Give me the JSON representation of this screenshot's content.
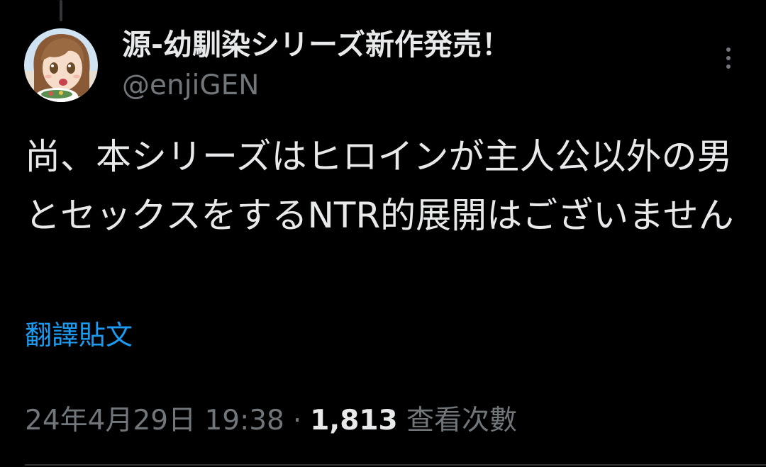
{
  "author": {
    "display_name": "源-幼馴染シリーズ新作発売！",
    "handle": "@enjiGEN",
    "avatar_icon": "anime-girl-avatar-icon"
  },
  "tweet": {
    "text": "尚、本シリーズはヒロインが主人公以外の男とセックスをするNTR的展開はございません",
    "translate_label": "翻譯貼文"
  },
  "meta": {
    "timestamp": "24年4月29日 19:38",
    "separator": "·",
    "views_count": "1,813",
    "views_label": "查看次數"
  },
  "icons": {
    "more": "more-vertical-icon"
  },
  "colors": {
    "background": "#000000",
    "primary_text": "#e7e9ea",
    "secondary_text": "#71767b",
    "link": "#1d9bf0"
  }
}
